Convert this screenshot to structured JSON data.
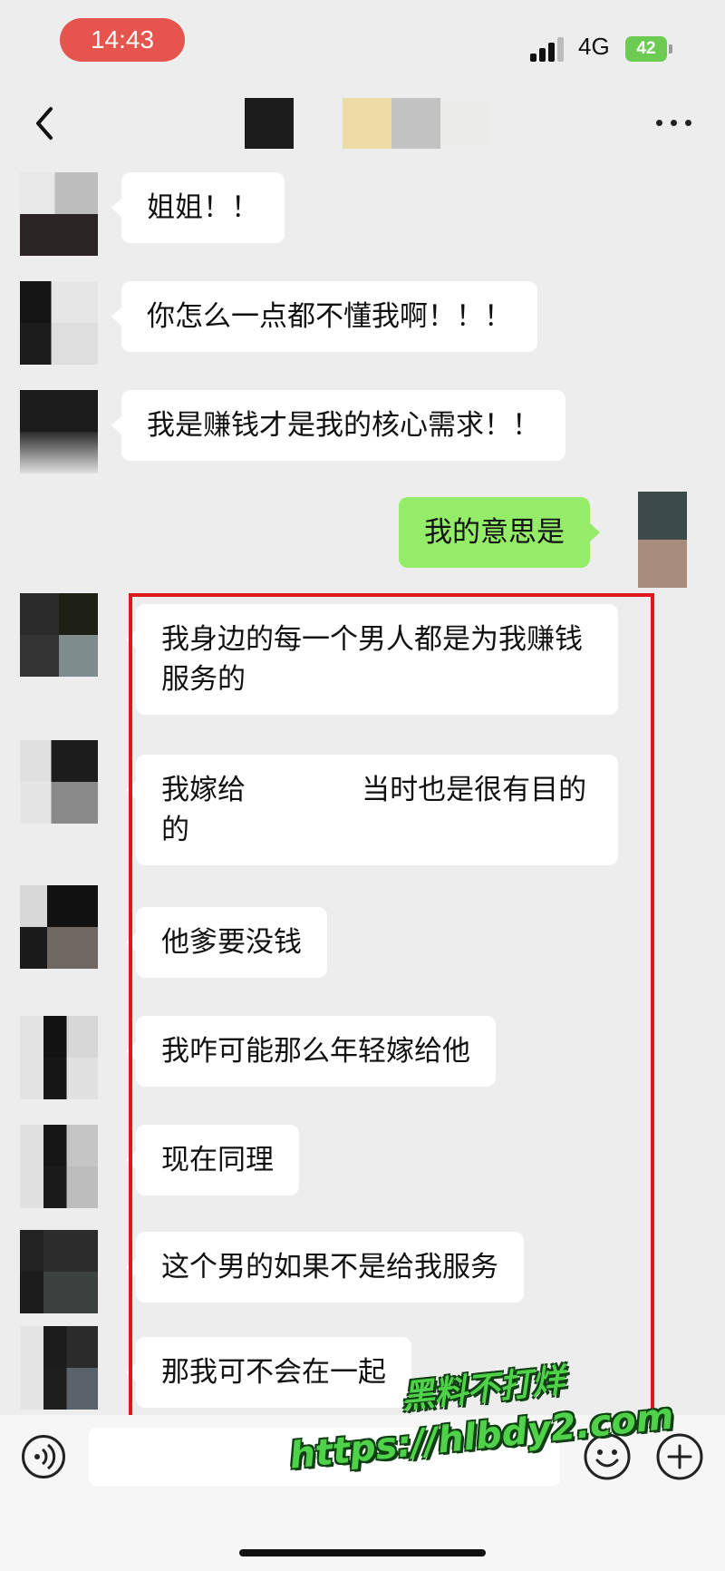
{
  "status_bar": {
    "time": "14:43",
    "network": "4G",
    "battery": "42"
  },
  "colors": {
    "time_pill": "#e5554e",
    "my_bubble": "#95ec69",
    "highlight_box": "#e0171c",
    "watermark": "#4fd14a"
  },
  "nav": {
    "back_icon": "chevron-left-icon",
    "more_icon": "more-horizontal-icon"
  },
  "messages": [
    {
      "from": "other",
      "text": "姐姐！！"
    },
    {
      "from": "other",
      "text": "你怎么一点都不懂我啊！！！"
    },
    {
      "from": "other",
      "text": "我是赚钱才是我的核心需求！！"
    },
    {
      "from": "me",
      "text": "我的意思是"
    },
    {
      "from": "other",
      "text": "我身边的每一个男人都是为我赚钱服务的"
    },
    {
      "from": "other",
      "text": "我嫁给             当时也是很有目的的"
    },
    {
      "from": "other",
      "text": "他爹要没钱"
    },
    {
      "from": "other",
      "text": "我咋可能那么年轻嫁给他"
    },
    {
      "from": "other",
      "text": "现在同理"
    },
    {
      "from": "other",
      "text": "这个男的如果不是给我服务"
    },
    {
      "from": "other",
      "text": "那我可不会在一起"
    }
  ],
  "input_bar": {
    "voice_icon": "voice-icon",
    "emoji_icon": "emoji-icon",
    "plus_icon": "plus-icon"
  },
  "watermark": {
    "line1": "黑料不打烊",
    "line2": "https://hlbdy2.com"
  }
}
